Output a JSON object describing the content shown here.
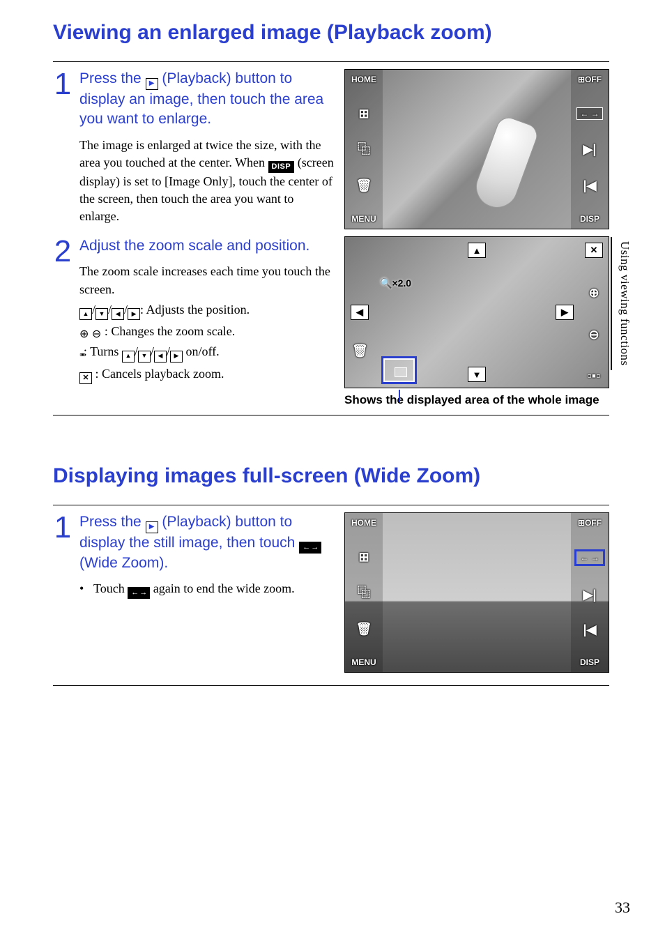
{
  "section1": {
    "title": "Viewing an enlarged image (Playback zoom)",
    "step1": {
      "num": "1",
      "head_a": "Press the ",
      "head_b": " (Playback) button to display an image, then touch the area you want to enlarge.",
      "body_a": "The image is enlarged at twice the size, with the area you touched at the center. When ",
      "disp": "DISP",
      "body_b": " (screen display) is set to [Image Only], touch the center of the screen, then touch the area you want to enlarge."
    },
    "step2": {
      "num": "2",
      "head": "Adjust the zoom scale and position.",
      "body_intro": "The zoom scale increases each time you touch the screen.",
      "line_adjust": ": Adjusts the position.",
      "line_zoom": " : Changes the zoom scale.",
      "line_toggle_a": ": Turns ",
      "line_toggle_b": " on/off.",
      "line_cancel": " : Cancels playback zoom.",
      "caption": "Shows the displayed area of the whole image"
    },
    "fig1": {
      "left": [
        "HOME",
        "⊞",
        "⿻",
        "🗑",
        "MENU"
      ],
      "right": [
        "⊞OFF",
        "← →",
        "▶|",
        "|◀",
        "DISP"
      ]
    },
    "fig2": {
      "zoom_label": "×2.0",
      "right": [
        "✕",
        "⊕",
        "⊖",
        "▫▪▫"
      ],
      "arrows": {
        "up": "▲",
        "down": "▼",
        "left": "◀",
        "right": "▶"
      },
      "trash": "🗑"
    }
  },
  "section2": {
    "title": "Displaying images full-screen (Wide Zoom)",
    "step1": {
      "num": "1",
      "head_a": "Press the ",
      "head_b": " (Playback) button to display the still image, then touch ",
      "head_c": " (Wide Zoom).",
      "bullet_a": "Touch ",
      "bullet_b": " again to end the wide zoom."
    },
    "fig3": {
      "left": [
        "HOME",
        "⊞",
        "⿻",
        "🗑",
        "MENU"
      ],
      "right": [
        "⊞OFF",
        "← →",
        "▶|",
        "|◀",
        "DISP"
      ]
    }
  },
  "side_tab": "Using viewing functions",
  "page_number": "33"
}
